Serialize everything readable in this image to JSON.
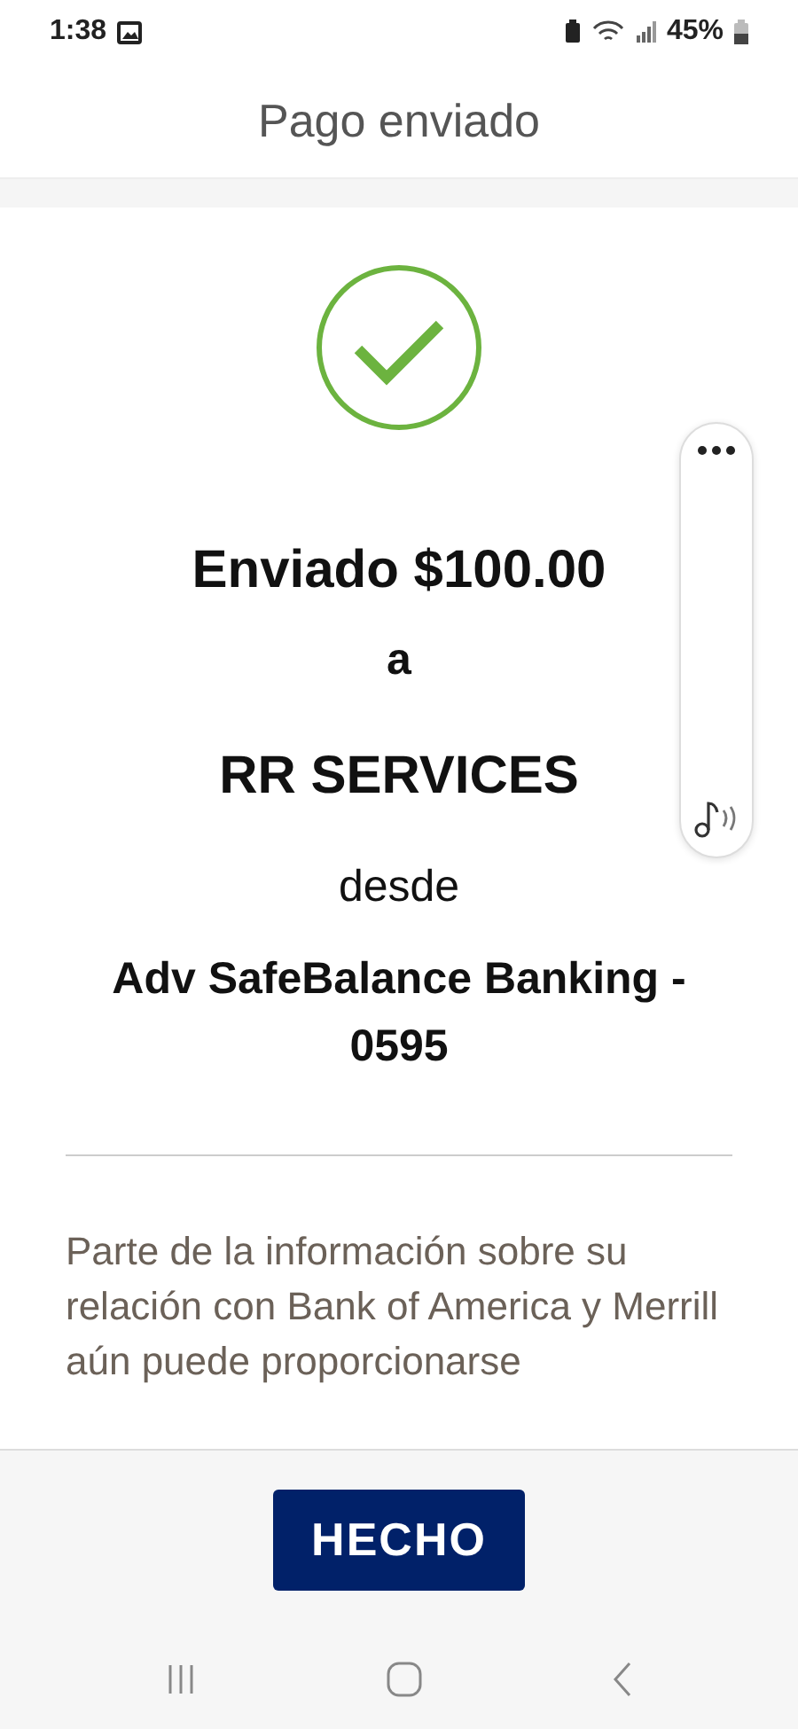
{
  "status_bar": {
    "time": "1:38",
    "battery": "45%"
  },
  "header": {
    "title": "Pago enviado"
  },
  "confirmation": {
    "amount_line": "Enviado $100.00",
    "to_word": "a",
    "payee": "RR SERVICES",
    "from_word": "desde",
    "account": "Adv SafeBalance Banking - 0595"
  },
  "notice": "Parte de la información sobre su relación con Bank of America y Merrill aún puede proporcionarse",
  "footer": {
    "button": "HECHO"
  }
}
